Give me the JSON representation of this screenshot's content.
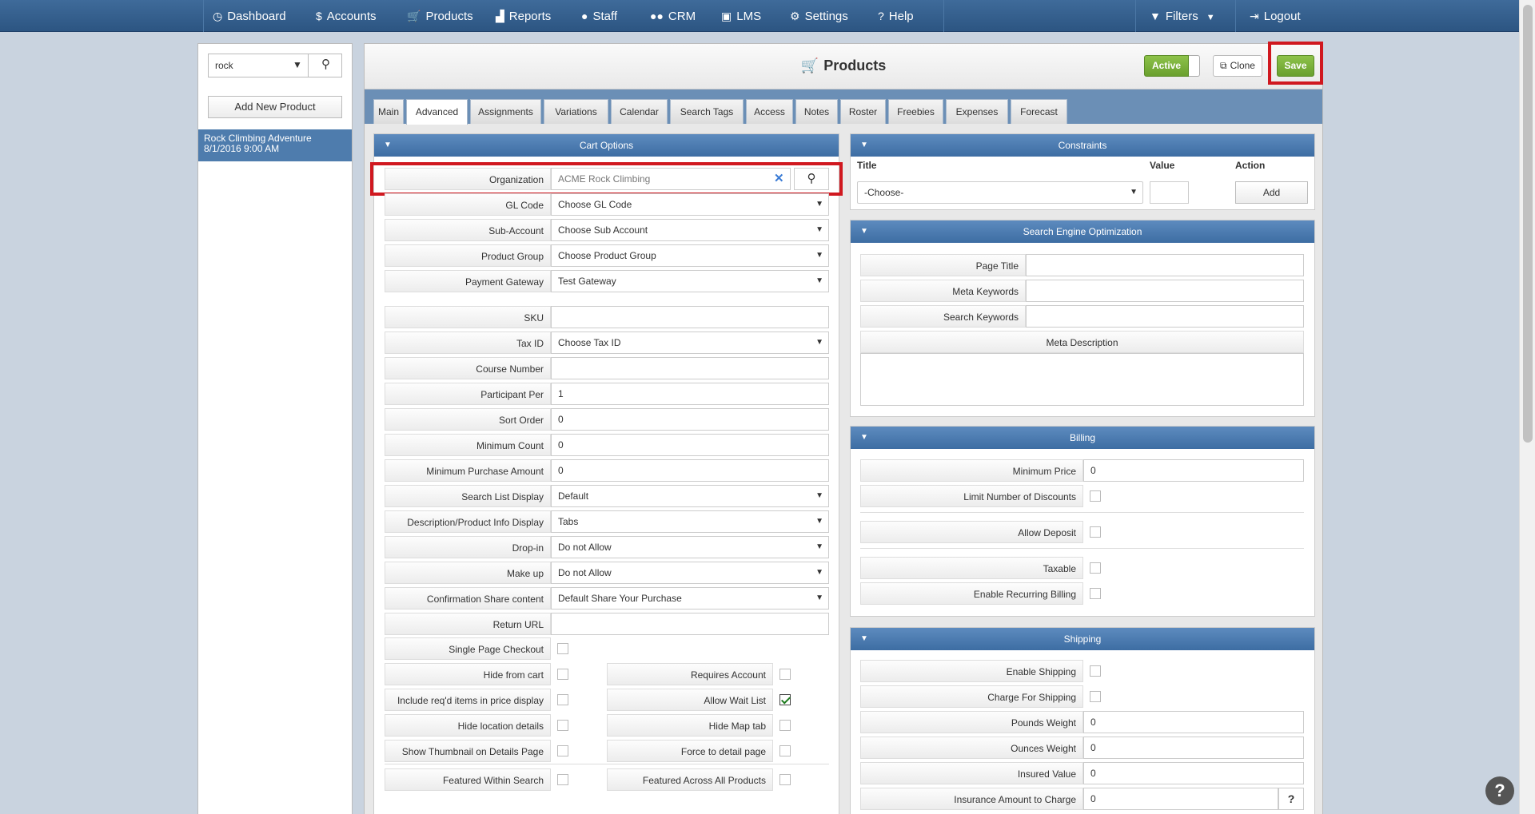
{
  "nav": {
    "items": [
      {
        "label": "Dashboard",
        "icon": "dashboard-icon"
      },
      {
        "label": "Accounts",
        "icon": "dollar-icon"
      },
      {
        "label": "Products",
        "icon": "cart-icon"
      },
      {
        "label": "Reports",
        "icon": "chart-icon"
      },
      {
        "label": "Staff",
        "icon": "user-icon"
      },
      {
        "label": "CRM",
        "icon": "users-icon"
      },
      {
        "label": "LMS",
        "icon": "book-icon"
      },
      {
        "label": "Settings",
        "icon": "gear-icon"
      },
      {
        "label": "Help",
        "icon": "question-icon"
      }
    ],
    "filters": "Filters",
    "logout": "Logout"
  },
  "sidebar": {
    "search_value": "rock",
    "add_new": "Add New Product",
    "product_name": "Rock Climbing Adventure",
    "product_date": "8/1/2016 9:00 AM"
  },
  "header": {
    "title": "Products",
    "active": "Active",
    "clone": "Clone",
    "save": "Save"
  },
  "tabs": [
    "Main",
    "Advanced",
    "Assignments",
    "Variations",
    "Calendar",
    "Search Tags",
    "Access",
    "Notes",
    "Roster",
    "Freebies",
    "Expenses",
    "Forecast"
  ],
  "active_tab": "Advanced",
  "cart": {
    "title": "Cart Options",
    "organization": {
      "label": "Organization",
      "value": "ACME Rock Climbing"
    },
    "selects": [
      {
        "label": "GL Code",
        "value": "Choose GL Code"
      },
      {
        "label": "Sub-Account",
        "value": "Choose Sub Account"
      },
      {
        "label": "Product Group",
        "value": "Choose Product Group"
      },
      {
        "label": "Payment Gateway",
        "value": "Test Gateway"
      }
    ],
    "fields": [
      {
        "label": "SKU",
        "value": "",
        "select": false
      },
      {
        "label": "Tax ID",
        "value": "Choose Tax ID",
        "select": true
      },
      {
        "label": "Course Number",
        "value": "",
        "select": false
      },
      {
        "label": "Participant Per",
        "value": "1",
        "select": false
      },
      {
        "label": "Sort Order",
        "value": "0",
        "select": false
      },
      {
        "label": "Minimum Count",
        "value": "0",
        "select": false
      },
      {
        "label": "Minimum Purchase Amount",
        "value": "0",
        "select": false
      },
      {
        "label": "Search List Display",
        "value": "Default",
        "select": true
      },
      {
        "label": "Description/Product Info Display",
        "value": "Tabs",
        "select": true
      },
      {
        "label": "Drop-in",
        "value": "Do not Allow",
        "select": true
      },
      {
        "label": "Make up",
        "value": "Do not Allow",
        "select": true
      },
      {
        "label": "Confirmation Share content",
        "value": "Default Share Your Purchase",
        "select": true
      },
      {
        "label": "Return URL",
        "value": "",
        "select": false
      }
    ],
    "single_page": {
      "label": "Single Page Checkout",
      "checked": false
    },
    "check_pairs": [
      {
        "left": {
          "label": "Hide from cart",
          "checked": false
        },
        "right": {
          "label": "Requires Account",
          "checked": false
        }
      },
      {
        "left": {
          "label": "Include req'd items in price display",
          "checked": false
        },
        "right": {
          "label": "Allow Wait List",
          "checked": true
        }
      },
      {
        "left": {
          "label": "Hide location details",
          "checked": false
        },
        "right": {
          "label": "Hide Map tab",
          "checked": false
        }
      },
      {
        "left": {
          "label": "Show Thumbnail on Details Page",
          "checked": false
        },
        "right": {
          "label": "Force to detail page",
          "checked": false
        }
      },
      {
        "left": {
          "label": "Featured Within Search",
          "checked": false
        },
        "right": {
          "label": "Featured Across All Products",
          "checked": false
        }
      }
    ]
  },
  "constraints": {
    "title": "Constraints",
    "col_title": "Title",
    "col_value": "Value",
    "col_action": "Action",
    "select_value": "-Choose-",
    "add": "Add"
  },
  "seo": {
    "title": "Search Engine Optimization",
    "page_title": "Page Title",
    "meta_keywords": "Meta Keywords",
    "search_keywords": "Search Keywords",
    "meta_description": "Meta Description"
  },
  "billing": {
    "title": "Billing",
    "min_price": {
      "label": "Minimum Price",
      "value": "0"
    },
    "checks": [
      {
        "label": "Limit Number of Discounts",
        "checked": false
      },
      {
        "label": "Allow Deposit",
        "checked": false
      },
      {
        "label": "Taxable",
        "checked": false
      },
      {
        "label": "Enable Recurring Billing",
        "checked": false
      }
    ]
  },
  "shipping": {
    "title": "Shipping",
    "checks": [
      {
        "label": "Enable Shipping",
        "checked": false
      },
      {
        "label": "Charge For Shipping",
        "checked": false
      }
    ],
    "fields": [
      {
        "label": "Pounds Weight",
        "value": "0"
      },
      {
        "label": "Ounces Weight",
        "value": "0"
      },
      {
        "label": "Insured Value",
        "value": "0"
      },
      {
        "label": "Insurance Amount to Charge",
        "value": "0"
      }
    ],
    "help": "?"
  },
  "help_bubble": "?"
}
